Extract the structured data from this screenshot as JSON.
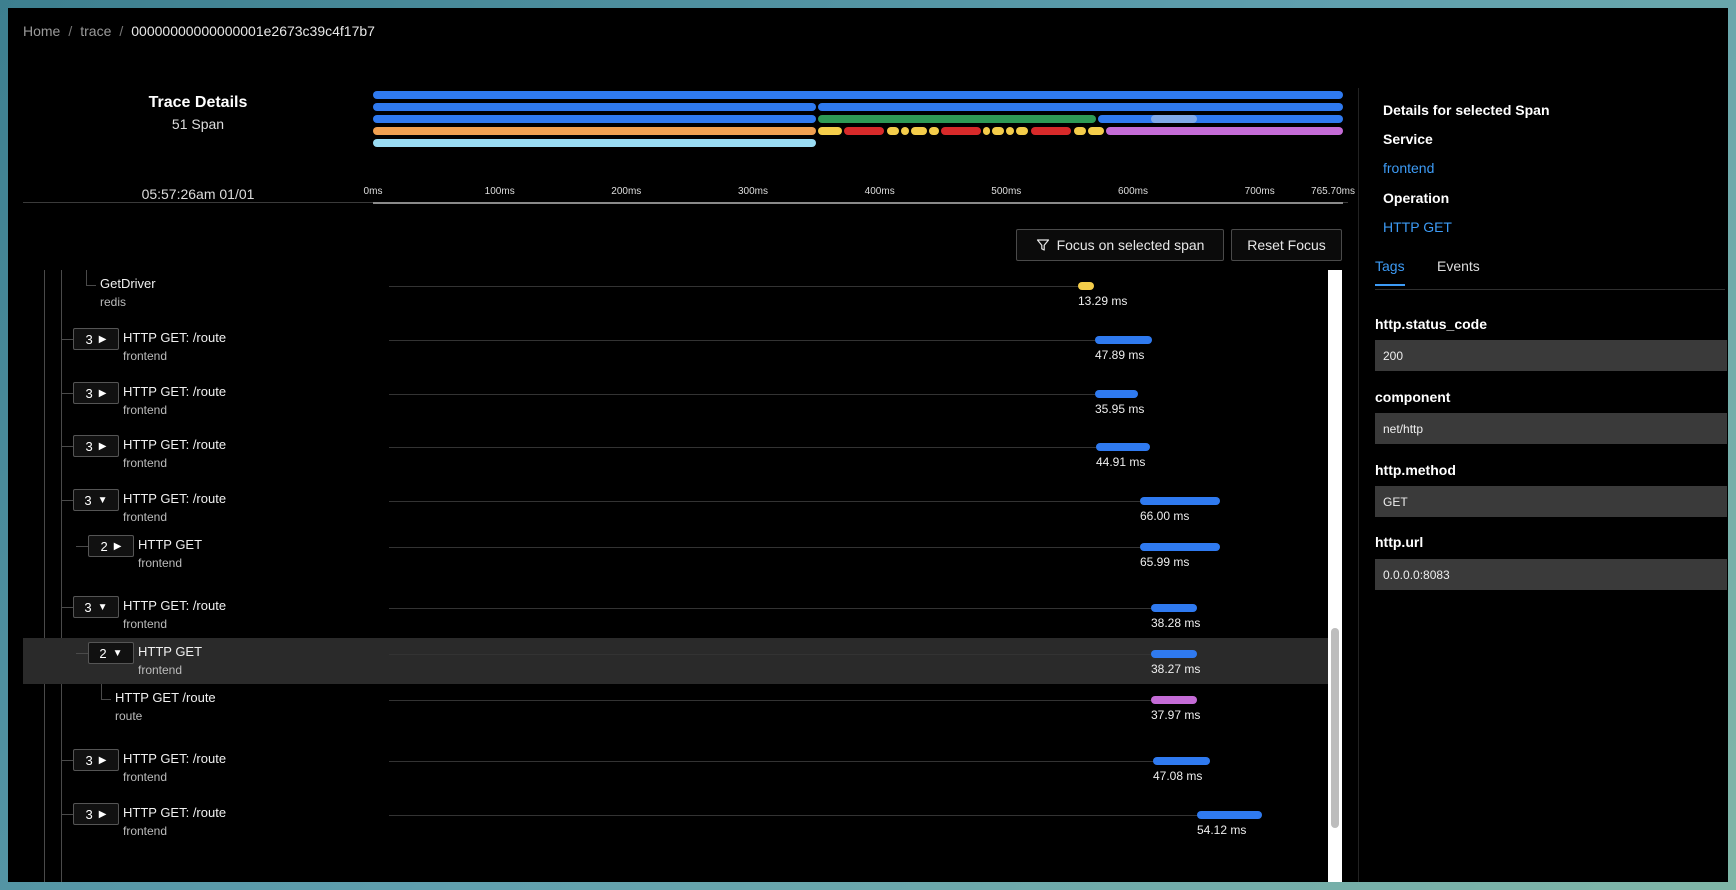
{
  "breadcrumb": {
    "items": [
      "Home",
      "trace",
      "00000000000000001e2673c39c4f17b7"
    ],
    "separator": "/"
  },
  "trace": {
    "title": "Trace Details",
    "span_count": "51 Span",
    "start_time": "05:57:26am 01/01"
  },
  "timeline": {
    "ticks": [
      "0ms",
      "100ms",
      "200ms",
      "300ms",
      "400ms",
      "500ms",
      "600ms",
      "700ms",
      "765.70ms"
    ]
  },
  "actions": {
    "focus_label": "Focus on selected span",
    "reset_label": "Reset Focus"
  },
  "colors": {
    "frontend": "#2f7af0",
    "redis": "#f4cd4a",
    "mysql": "#f0a050",
    "driver": "#2e9a55",
    "route": "#c46bd6",
    "customer": "#9adcf4",
    "error": "#d82a2a",
    "link": "#3d9bf5"
  },
  "spans": [
    {
      "name": "GetDriver",
      "service": "redis",
      "duration": "13.29 ms",
      "color": "#f4cd4a",
      "count": "",
      "caret": "",
      "selected": false
    },
    {
      "name": "HTTP GET: /route",
      "service": "frontend",
      "duration": "47.89 ms",
      "color": "#2f7af0",
      "count": "3",
      "caret": "right",
      "selected": false
    },
    {
      "name": "HTTP GET: /route",
      "service": "frontend",
      "duration": "35.95 ms",
      "color": "#2f7af0",
      "count": "3",
      "caret": "right",
      "selected": false
    },
    {
      "name": "HTTP GET: /route",
      "service": "frontend",
      "duration": "44.91 ms",
      "color": "#2f7af0",
      "count": "3",
      "caret": "right",
      "selected": false
    },
    {
      "name": "HTTP GET: /route",
      "service": "frontend",
      "duration": "66.00 ms",
      "color": "#2f7af0",
      "count": "3",
      "caret": "down",
      "selected": false
    },
    {
      "name": "HTTP GET",
      "service": "frontend",
      "duration": "65.99 ms",
      "color": "#2f7af0",
      "count": "2",
      "caret": "right",
      "selected": false
    },
    {
      "name": "HTTP GET: /route",
      "service": "frontend",
      "duration": "38.28 ms",
      "color": "#2f7af0",
      "count": "3",
      "caret": "down",
      "selected": false
    },
    {
      "name": "HTTP GET",
      "service": "frontend",
      "duration": "38.27 ms",
      "color": "#2f7af0",
      "count": "2",
      "caret": "down",
      "selected": true
    },
    {
      "name": "HTTP GET /route",
      "service": "route",
      "duration": "37.97 ms",
      "color": "#c46bd6",
      "count": "",
      "caret": "",
      "selected": false
    },
    {
      "name": "HTTP GET: /route",
      "service": "frontend",
      "duration": "47.08 ms",
      "color": "#2f7af0",
      "count": "3",
      "caret": "right",
      "selected": false
    },
    {
      "name": "HTTP GET: /route",
      "service": "frontend",
      "duration": "54.12 ms",
      "color": "#2f7af0",
      "count": "3",
      "caret": "right",
      "selected": false
    }
  ],
  "details": {
    "title": "Details for selected Span",
    "service_label": "Service",
    "service_value": "frontend",
    "operation_label": "Operation",
    "operation_value": "HTTP GET",
    "tabs": [
      "Tags",
      "Events"
    ],
    "active_tab": "Tags",
    "tags": [
      {
        "key": "http.status_code",
        "value": "200"
      },
      {
        "key": "component",
        "value": "net/http"
      },
      {
        "key": "http.method",
        "value": "GET"
      },
      {
        "key": "http.url",
        "value": "0.0.0.0:8083"
      }
    ]
  }
}
